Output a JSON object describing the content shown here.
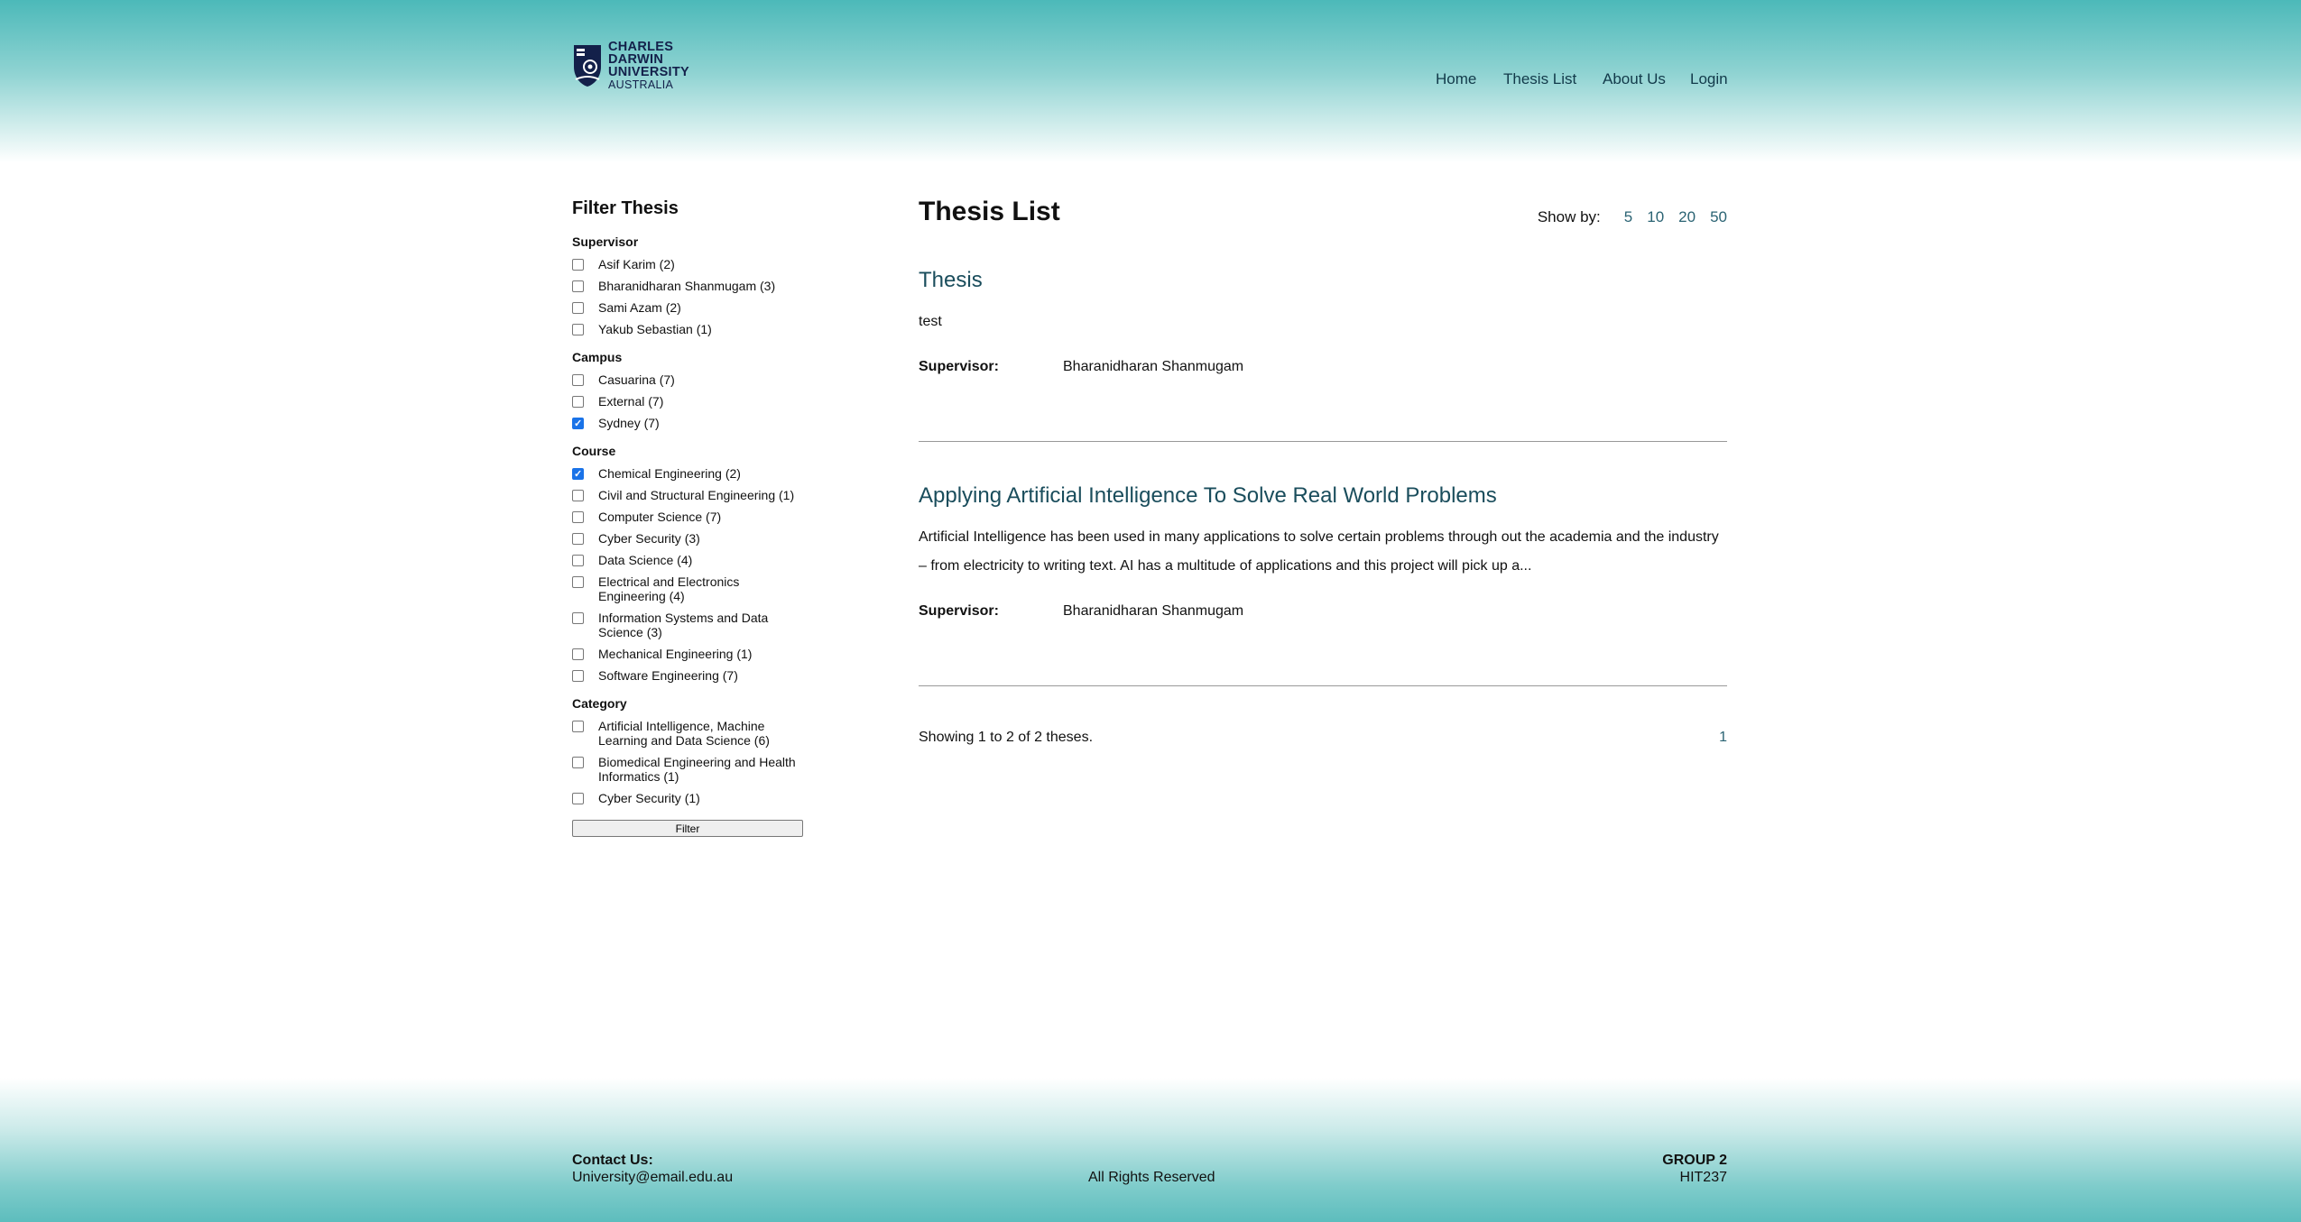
{
  "header": {
    "logo": {
      "line1": "CHARLES",
      "line2": "DARWIN",
      "line3": "UNIVERSITY",
      "line4": "AUSTRALIA"
    },
    "nav": [
      "Home",
      "Thesis List",
      "About Us",
      "Login"
    ]
  },
  "filter": {
    "title": "Filter Thesis",
    "groups": [
      {
        "title": "Supervisor",
        "options": [
          {
            "label": "Asif Karim (2)",
            "checked": false
          },
          {
            "label": "Bharanidharan Shanmugam (3)",
            "checked": false
          },
          {
            "label": "Sami Azam (2)",
            "checked": false
          },
          {
            "label": "Yakub Sebastian (1)",
            "checked": false
          }
        ]
      },
      {
        "title": "Campus",
        "options": [
          {
            "label": "Casuarina (7)",
            "checked": false
          },
          {
            "label": "External (7)",
            "checked": false
          },
          {
            "label": "Sydney (7)",
            "checked": true
          }
        ]
      },
      {
        "title": "Course",
        "options": [
          {
            "label": "Chemical Engineering (2)",
            "checked": true
          },
          {
            "label": "Civil and Structural Engineering (1)",
            "checked": false
          },
          {
            "label": "Computer Science (7)",
            "checked": false
          },
          {
            "label": "Cyber Security (3)",
            "checked": false
          },
          {
            "label": "Data Science (4)",
            "checked": false
          },
          {
            "label": "Electrical and Electronics Engineering (4)",
            "checked": false
          },
          {
            "label": "Information Systems and Data Science (3)",
            "checked": false
          },
          {
            "label": "Mechanical Engineering (1)",
            "checked": false
          },
          {
            "label": "Software Engineering (7)",
            "checked": false
          }
        ]
      },
      {
        "title": "Category",
        "options": [
          {
            "label": "Artificial Intelligence, Machine Learning and Data Science (6)",
            "checked": false
          },
          {
            "label": "Biomedical Engineering and Health Informatics (1)",
            "checked": false
          },
          {
            "label": "Cyber Security (1)",
            "checked": false
          }
        ]
      }
    ],
    "button_label": "Filter"
  },
  "main": {
    "title": "Thesis List",
    "show_by_label": "Show by:",
    "show_by_options": [
      "5",
      "10",
      "20",
      "50"
    ],
    "entries": [
      {
        "title": "Thesis",
        "description": "test",
        "supervisor_label": "Supervisor:",
        "supervisor": "Bharanidharan Shanmugam"
      },
      {
        "title": "Applying Artificial Intelligence To Solve Real World Problems",
        "description": "Artificial Intelligence has been used in many applications to solve certain problems through out the academia and the industry – from electricity to writing text. AI has a multitude of applications and this project will pick up a...",
        "supervisor_label": "Supervisor:",
        "supervisor": "Bharanidharan Shanmugam"
      }
    ],
    "showing_text": "Showing 1 to 2 of 2 theses.",
    "pages": [
      "1"
    ]
  },
  "footer": {
    "contact_label": "Contact Us:",
    "email": "University@email.edu.au",
    "rights": "All Rights Reserved",
    "group": "GROUP 2",
    "code": "HIT237"
  },
  "colors": {
    "teal": "#4cb9b9",
    "link": "#2a6373",
    "heading": "#1a4d5c",
    "checkbox": "#1a73e8"
  }
}
